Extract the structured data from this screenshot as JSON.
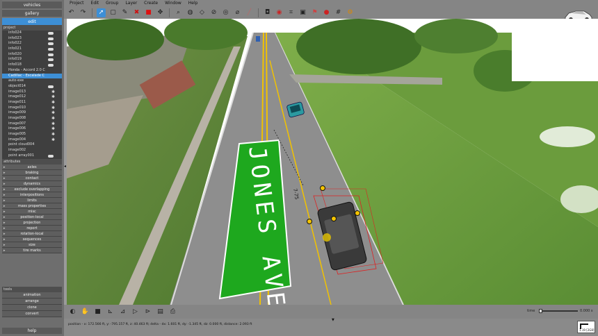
{
  "sidebar": {
    "categories": [
      "vehicles",
      "gallery",
      "edit"
    ],
    "selected_category": "edit",
    "project_label": "project",
    "tree_items": [
      {
        "label": "info024",
        "icon": "eye-icon"
      },
      {
        "label": "info023",
        "icon": "eye-icon"
      },
      {
        "label": "info022",
        "icon": "eye-icon"
      },
      {
        "label": "info021",
        "icon": "eye-icon"
      },
      {
        "label": "info020",
        "icon": "eye-icon"
      },
      {
        "label": "info019",
        "icon": "eye-icon"
      },
      {
        "label": "info018",
        "icon": "eye-icon"
      },
      {
        "label": "Honda - Accord 2.0 C",
        "icon": ""
      },
      {
        "label": "Cadillac - Escalade C",
        "icon": "",
        "highlighted": true
      },
      {
        "label": "auto-exe",
        "icon": ""
      },
      {
        "label": "object014",
        "icon": "eye-icon"
      },
      {
        "label": "image013",
        "icon": "asterisk-icon"
      },
      {
        "label": "image012",
        "icon": "asterisk-icon"
      },
      {
        "label": "image011",
        "icon": "asterisk-icon"
      },
      {
        "label": "image010",
        "icon": "asterisk-icon"
      },
      {
        "label": "image009",
        "icon": "asterisk-icon"
      },
      {
        "label": "image008",
        "icon": "asterisk-icon"
      },
      {
        "label": "image007",
        "icon": "asterisk-icon"
      },
      {
        "label": "image006",
        "icon": "asterisk-icon"
      },
      {
        "label": "image005",
        "icon": "asterisk-icon"
      },
      {
        "label": "image004",
        "icon": "asterisk-icon"
      },
      {
        "label": "point cloud004",
        "icon": ""
      },
      {
        "label": "image002",
        "icon": ""
      },
      {
        "label": "point array001",
        "icon": "eye-icon"
      }
    ],
    "attributes_label": "attributes",
    "properties": [
      "axles",
      "braking",
      "contact",
      "dynamics",
      "exclude overlapping",
      "interpositions",
      "limits",
      "mass properties",
      "misc",
      "position-local",
      "projection",
      "report",
      "rotation-local",
      "sequences",
      "size",
      "tire marks"
    ],
    "tools_label": "tools",
    "tools": [
      "animation",
      "arrange",
      "clone",
      "convert"
    ],
    "help": "help"
  },
  "menu": [
    "Project",
    "Edit",
    "Group",
    "Layer",
    "Create",
    "Window",
    "Help"
  ],
  "toolbar_icons": [
    "undo-icon",
    "redo-icon",
    "select-arrow-icon",
    "select-box-icon",
    "pencil-icon",
    "delete-x-icon",
    "red-cube-icon",
    "zoom-icon",
    "move-icon",
    "ruler-icon",
    "diamond-icon",
    "link-icon",
    "dial-icon",
    "scale-icon",
    "stick-icon",
    "camera-icon",
    "target-icon",
    "crop-icon",
    "image-icon",
    "tag-icon",
    "colors-icon",
    "grid-icon",
    "settings-icon"
  ],
  "viewport": {
    "sign_text": "JONES AVE",
    "road_label": "7-75"
  },
  "bottom": {
    "time_label": "time",
    "time_value": "0.000 s"
  },
  "status": "position - x: 172.566 ft, y: -795.157 ft, z: 40.463 ft; delta - dx: 1.601 ft, dy: -1.345 ft, dz: 0.000 ft, distance: 2.093 ft",
  "scale_label": "1.19 [2G8]",
  "colors": {
    "accent": "#3d8fd6",
    "grass": "#5a8a3a",
    "road": "#8e8e8e",
    "sign": "#1ea81e",
    "lane": "#f2c200"
  }
}
